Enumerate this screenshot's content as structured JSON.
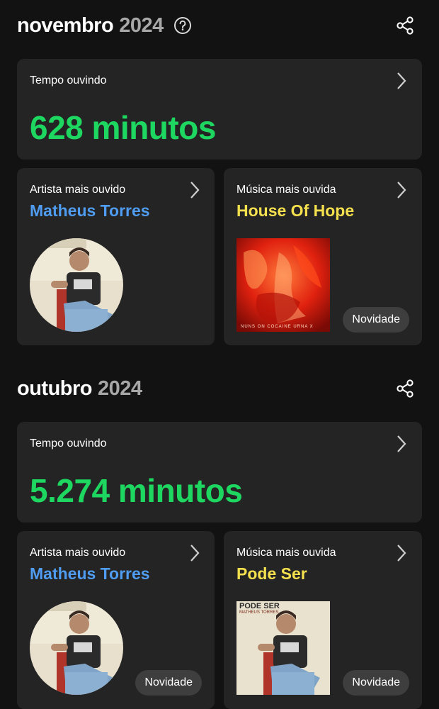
{
  "months": [
    {
      "month": "novembro",
      "year": "2024",
      "show_help": true,
      "listening": {
        "label": "Tempo ouvindo",
        "value": "628 minutos"
      },
      "top_artist": {
        "label": "Artista mais ouvido",
        "name": "Matheus Torres"
      },
      "top_song": {
        "label": "Música mais ouvida",
        "name": "House Of Hope",
        "badge": "Novidade",
        "cover_text": "NUNS ON COCAINE  URNA X"
      }
    },
    {
      "month": "outubro",
      "year": "2024",
      "show_help": false,
      "listening": {
        "label": "Tempo ouvindo",
        "value": "5.274 minutos"
      },
      "top_artist": {
        "label": "Artista mais ouvido",
        "name": "Matheus Torres",
        "badge": "Novidade"
      },
      "top_song": {
        "label": "Música mais ouvida",
        "name": "Pode Ser",
        "badge": "Novidade",
        "cover_title": "PODE SER",
        "cover_artist": "MATHEUS TORRES"
      }
    }
  ],
  "colors": {
    "background": "#121212",
    "card": "#242424",
    "minutes": "#1ed760",
    "artist": "#4f9cf0",
    "song": "#f5e04e",
    "badge": "#3e3e3e"
  },
  "icons": [
    "help-icon",
    "share-icon",
    "chevron-right-icon"
  ]
}
